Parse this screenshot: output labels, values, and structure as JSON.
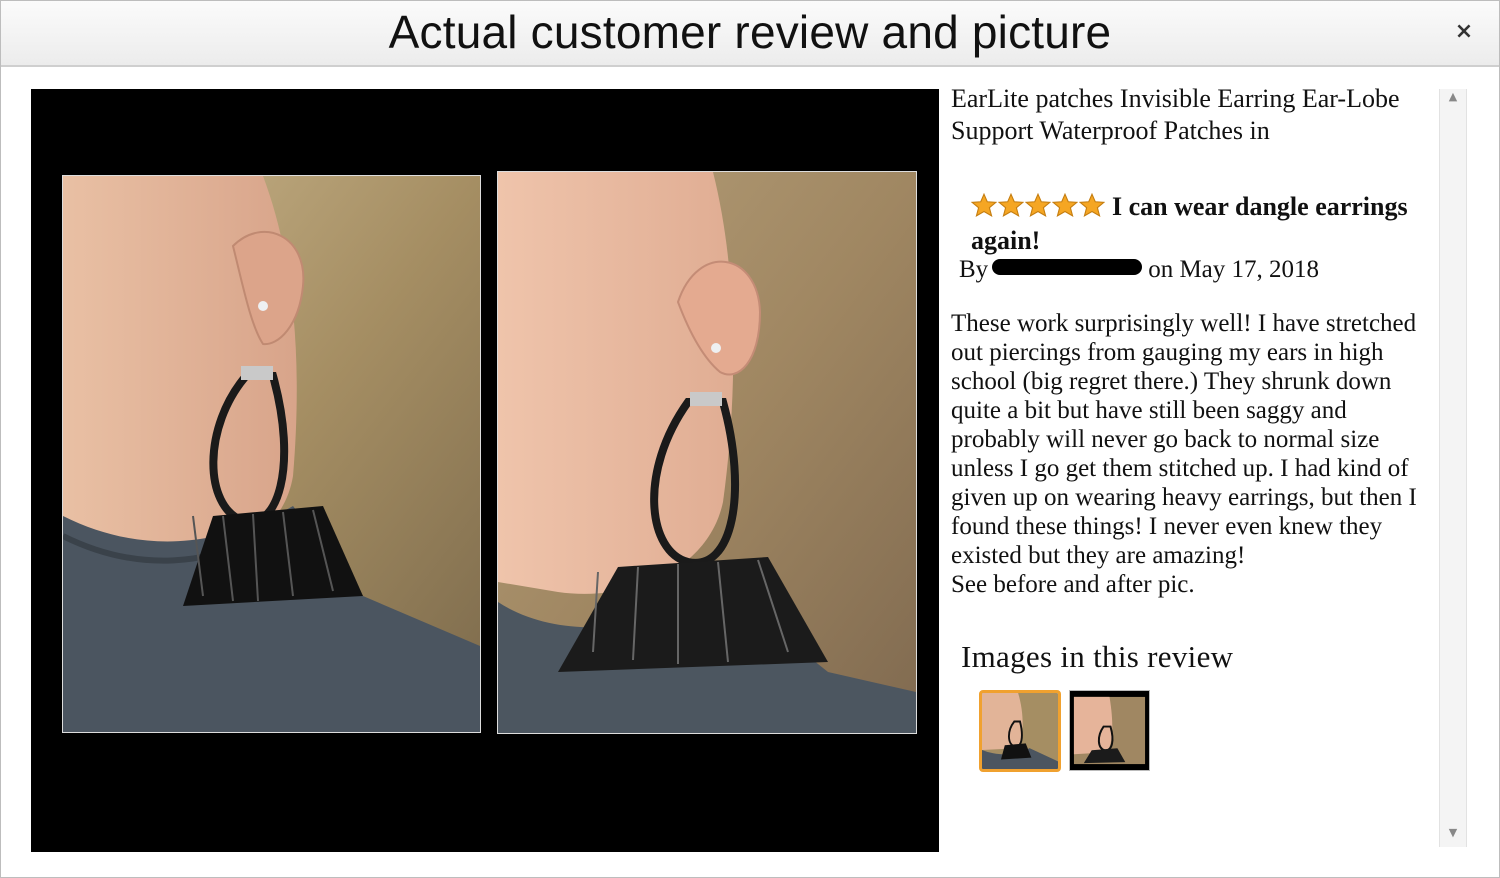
{
  "dialog": {
    "title": "Actual customer review and picture",
    "close_icon": "×"
  },
  "product": {
    "title": "EarLite  patches Invisible Earring Ear-Lobe Support Waterproof Patches in"
  },
  "review": {
    "rating": 5,
    "rating_max": 5,
    "headline": "I can wear dangle earrings again!",
    "by_prefix": "By",
    "date": "on May 17, 2018",
    "body": "These work surprisingly well! I have stretched out piercings from gauging my ears in high school (big regret there.) They shrunk down quite a bit but have still been saggy and probably will never go back to normal size unless I go get them stitched up. I had kind of given up on wearing heavy earrings, but then I found these things! I never even knew they existed but they are amazing!\nSee before and after pic."
  },
  "images": {
    "heading": "Images in this review",
    "selected_index": 0
  },
  "colors": {
    "star": "#f5a623",
    "thumb_selected_border": "#f0a12f",
    "photo_background": "#000000"
  },
  "scrollbar": {
    "up_icon": "▲",
    "down_icon": "▼"
  }
}
